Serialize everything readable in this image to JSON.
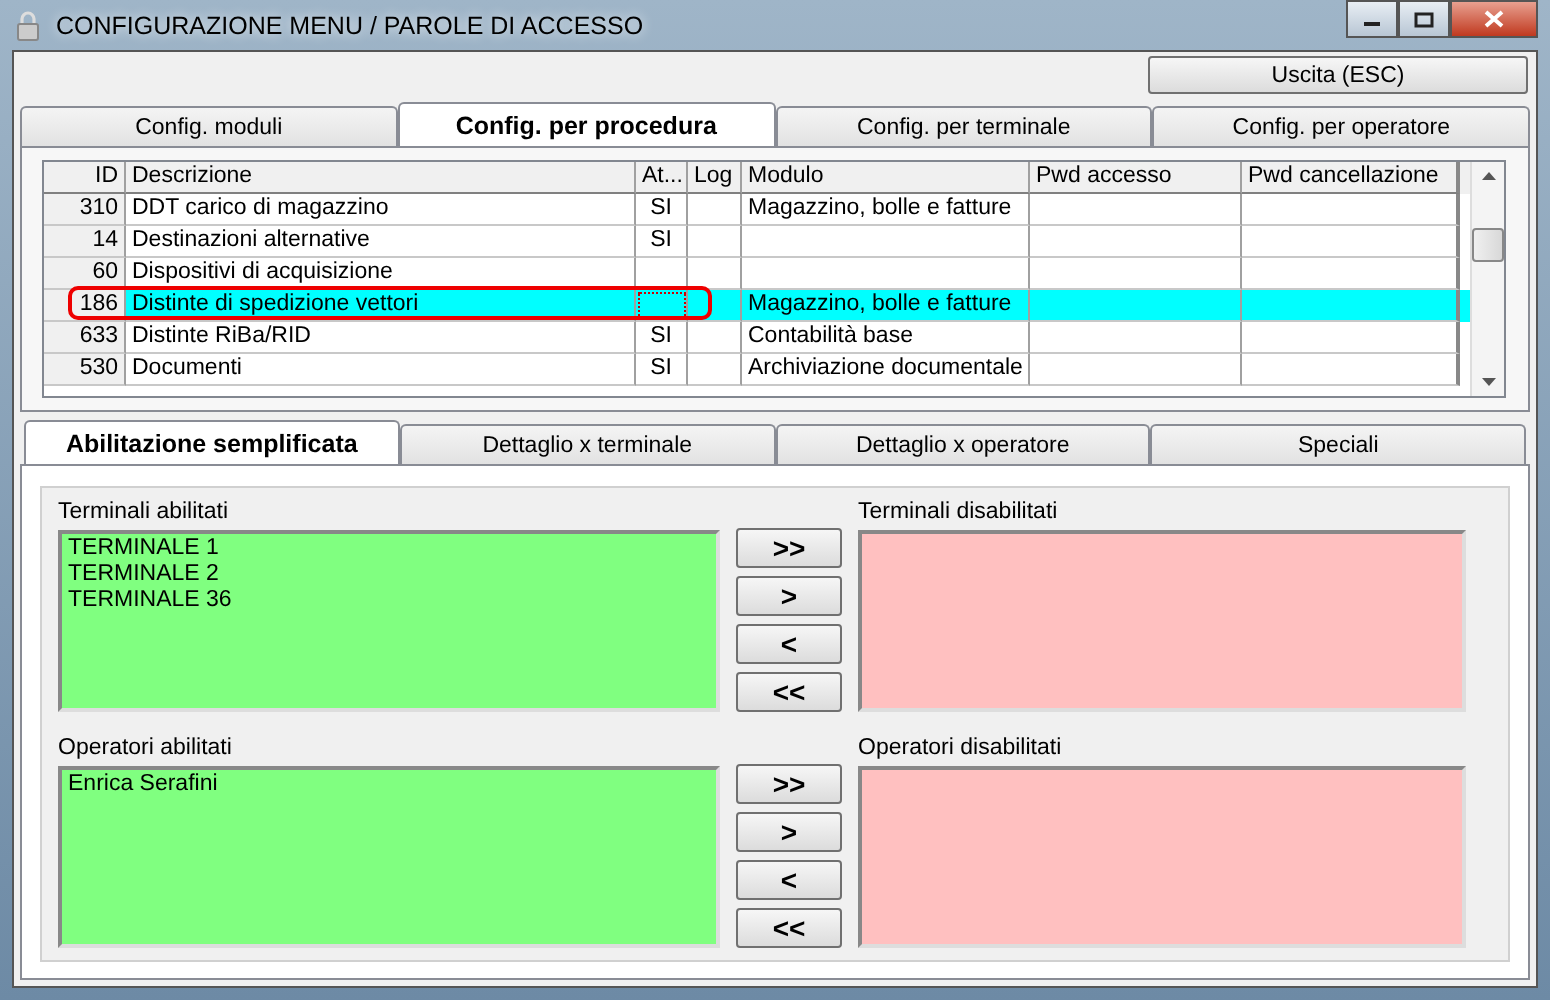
{
  "window": {
    "title": "CONFIGURAZIONE MENU / PAROLE DI ACCESSO"
  },
  "exit_button": "Uscita (ESC)",
  "tabs": [
    {
      "label": "Config. moduli",
      "selected": false
    },
    {
      "label": "Config. per procedura",
      "selected": true
    },
    {
      "label": "Config. per terminale",
      "selected": false
    },
    {
      "label": "Config. per operatore",
      "selected": false
    }
  ],
  "table": {
    "columns": [
      "ID",
      "Descrizione",
      "At...",
      "Log",
      "Modulo",
      "Pwd accesso",
      "Pwd cancellazione"
    ],
    "rows": [
      {
        "id": "310",
        "descrizione": "DDT carico di magazzino",
        "attivo": "SI",
        "modulo": "Magazzino, bolle e fatture",
        "selected": false,
        "highlighted": false
      },
      {
        "id": "14",
        "descrizione": "Destinazioni alternative",
        "attivo": "SI",
        "modulo": "",
        "selected": false,
        "highlighted": false
      },
      {
        "id": "60",
        "descrizione": "Dispositivi di acquisizione",
        "attivo": "",
        "modulo": "",
        "selected": false,
        "highlighted": false
      },
      {
        "id": "186",
        "descrizione": "Distinte di spedizione vettori",
        "attivo": "",
        "modulo": "Magazzino, bolle e fatture",
        "selected": true,
        "highlighted": true
      },
      {
        "id": "633",
        "descrizione": "Distinte RiBa/RID",
        "attivo": "SI",
        "modulo": "Contabilità base",
        "selected": false,
        "highlighted": false
      },
      {
        "id": "530",
        "descrizione": "Documenti",
        "attivo": "SI",
        "modulo": "Archiviazione documentale",
        "selected": false,
        "highlighted": false
      }
    ]
  },
  "sub_tabs": [
    {
      "label": "Abilitazione semplificata",
      "selected": true
    },
    {
      "label": "Dettaglio x terminale",
      "selected": false
    },
    {
      "label": "Dettaglio x operatore",
      "selected": false
    },
    {
      "label": "Speciali",
      "selected": false
    }
  ],
  "sections": [
    {
      "enabled_label": "Terminali abilitati",
      "enabled_items": [
        "TERMINALE 1",
        "TERMINALE 2",
        "TERMINALE 36"
      ],
      "disabled_label": "Terminali disabilitati",
      "buttons": [
        ">>",
        ">",
        "<",
        "<<"
      ]
    },
    {
      "enabled_label": "Operatori abilitati",
      "enabled_items": [
        "Enrica Serafini"
      ],
      "disabled_label": "Operatori disabilitati",
      "buttons": [
        ">>",
        ">",
        "<",
        "<<"
      ]
    }
  ]
}
